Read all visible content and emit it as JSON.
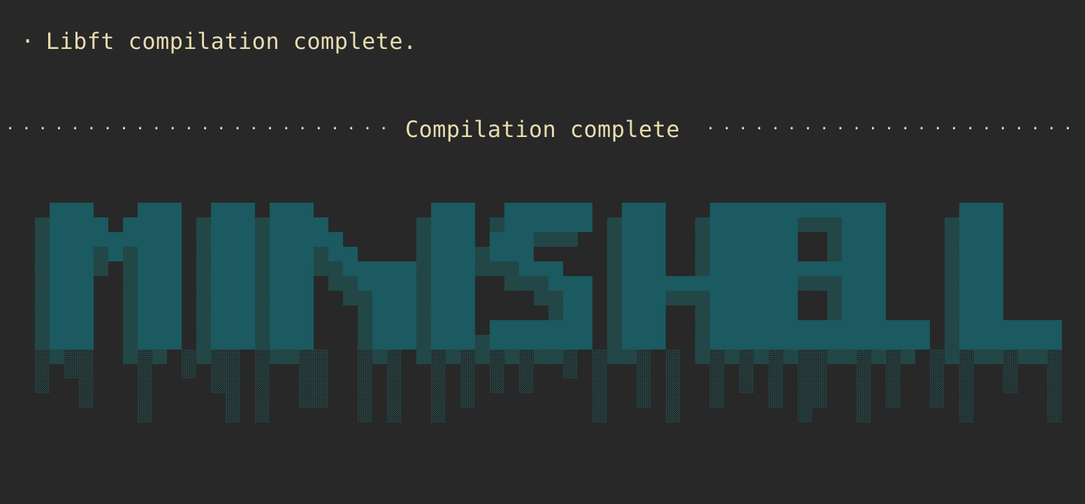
{
  "terminal": {
    "status_bullet": "·",
    "status_text": "Libft compilation complete.",
    "banner_text": "Compilation complete",
    "banner_fill_char": "·"
  },
  "logo": {
    "text": "MINISHELL",
    "style": "pixel-art drip font",
    "colors": {
      "background": "#282828",
      "primary": "#1a5a60",
      "shadow": "#1f4748",
      "drip": "#244646"
    }
  }
}
